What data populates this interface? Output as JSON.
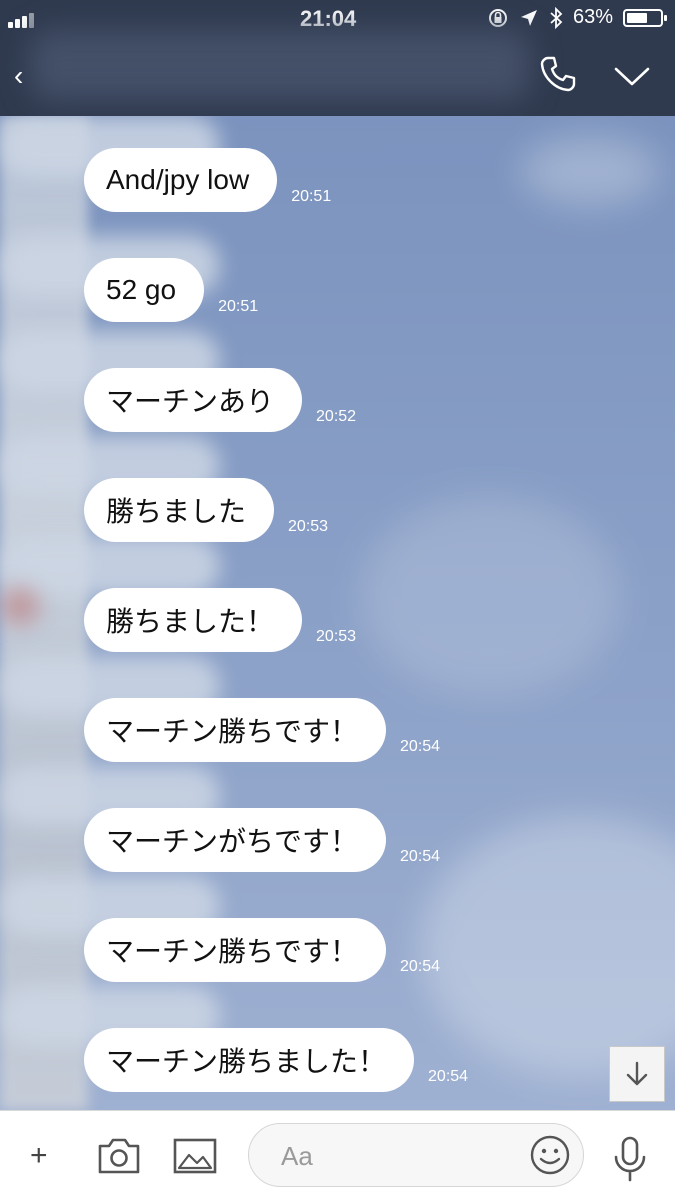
{
  "status_bar": {
    "time": "21:04",
    "battery_percent": "63%",
    "battery_level": 0.63
  },
  "header": {
    "back_glyph": "‹",
    "icons": [
      "phone-icon",
      "chevron-down-icon"
    ]
  },
  "messages": [
    {
      "text": "And/jpy low",
      "time": "20:51"
    },
    {
      "text": "52 go",
      "time": "20:51"
    },
    {
      "text": "マーチンあり",
      "time": "20:52"
    },
    {
      "text": "勝ちました",
      "time": "20:53"
    },
    {
      "text": "勝ちました！",
      "time": "20:53"
    },
    {
      "text": "マーチン勝ちです！",
      "time": "20:54"
    },
    {
      "text": "マーチンがちです！",
      "time": "20:54"
    },
    {
      "text": "マーチン勝ちです！",
      "time": "20:54"
    },
    {
      "text": "マーチン勝ちました！",
      "time": "20:54"
    }
  ],
  "input": {
    "placeholder": "Aa",
    "plus_glyph": "+"
  },
  "colors": {
    "header_bg": "#2f3a4f",
    "chat_bg": "#7f97bf",
    "bubble_bg": "#ffffff"
  }
}
